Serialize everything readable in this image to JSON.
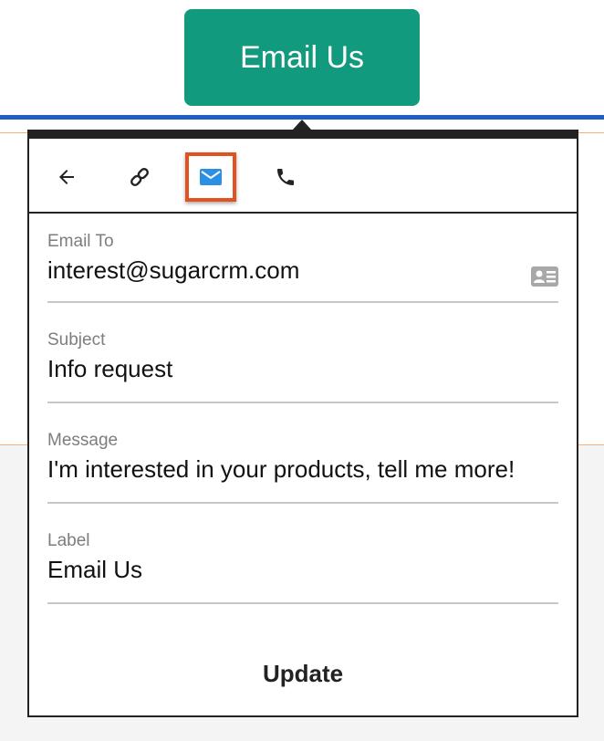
{
  "cta": {
    "label": "Email Us"
  },
  "toolbar": {
    "icons": [
      "arrow-back-icon",
      "link-icon",
      "email-icon",
      "phone-icon"
    ],
    "selected": "email",
    "highlight_color": "#e0521f",
    "active_icon_color": "#2b8fe6"
  },
  "form": {
    "email_to": {
      "label": "Email To",
      "value": "interest@sugarcrm.com"
    },
    "subject": {
      "label": "Subject",
      "value": "Info request"
    },
    "message": {
      "label": "Message",
      "value": "I'm interested in your products, tell me more!"
    },
    "button_label": {
      "label": "Label",
      "value": "Email Us"
    },
    "update_label": "Update"
  },
  "colors": {
    "button": "#129a7f",
    "top_bar": "#1f5fbf",
    "popover_border": "#222222"
  }
}
